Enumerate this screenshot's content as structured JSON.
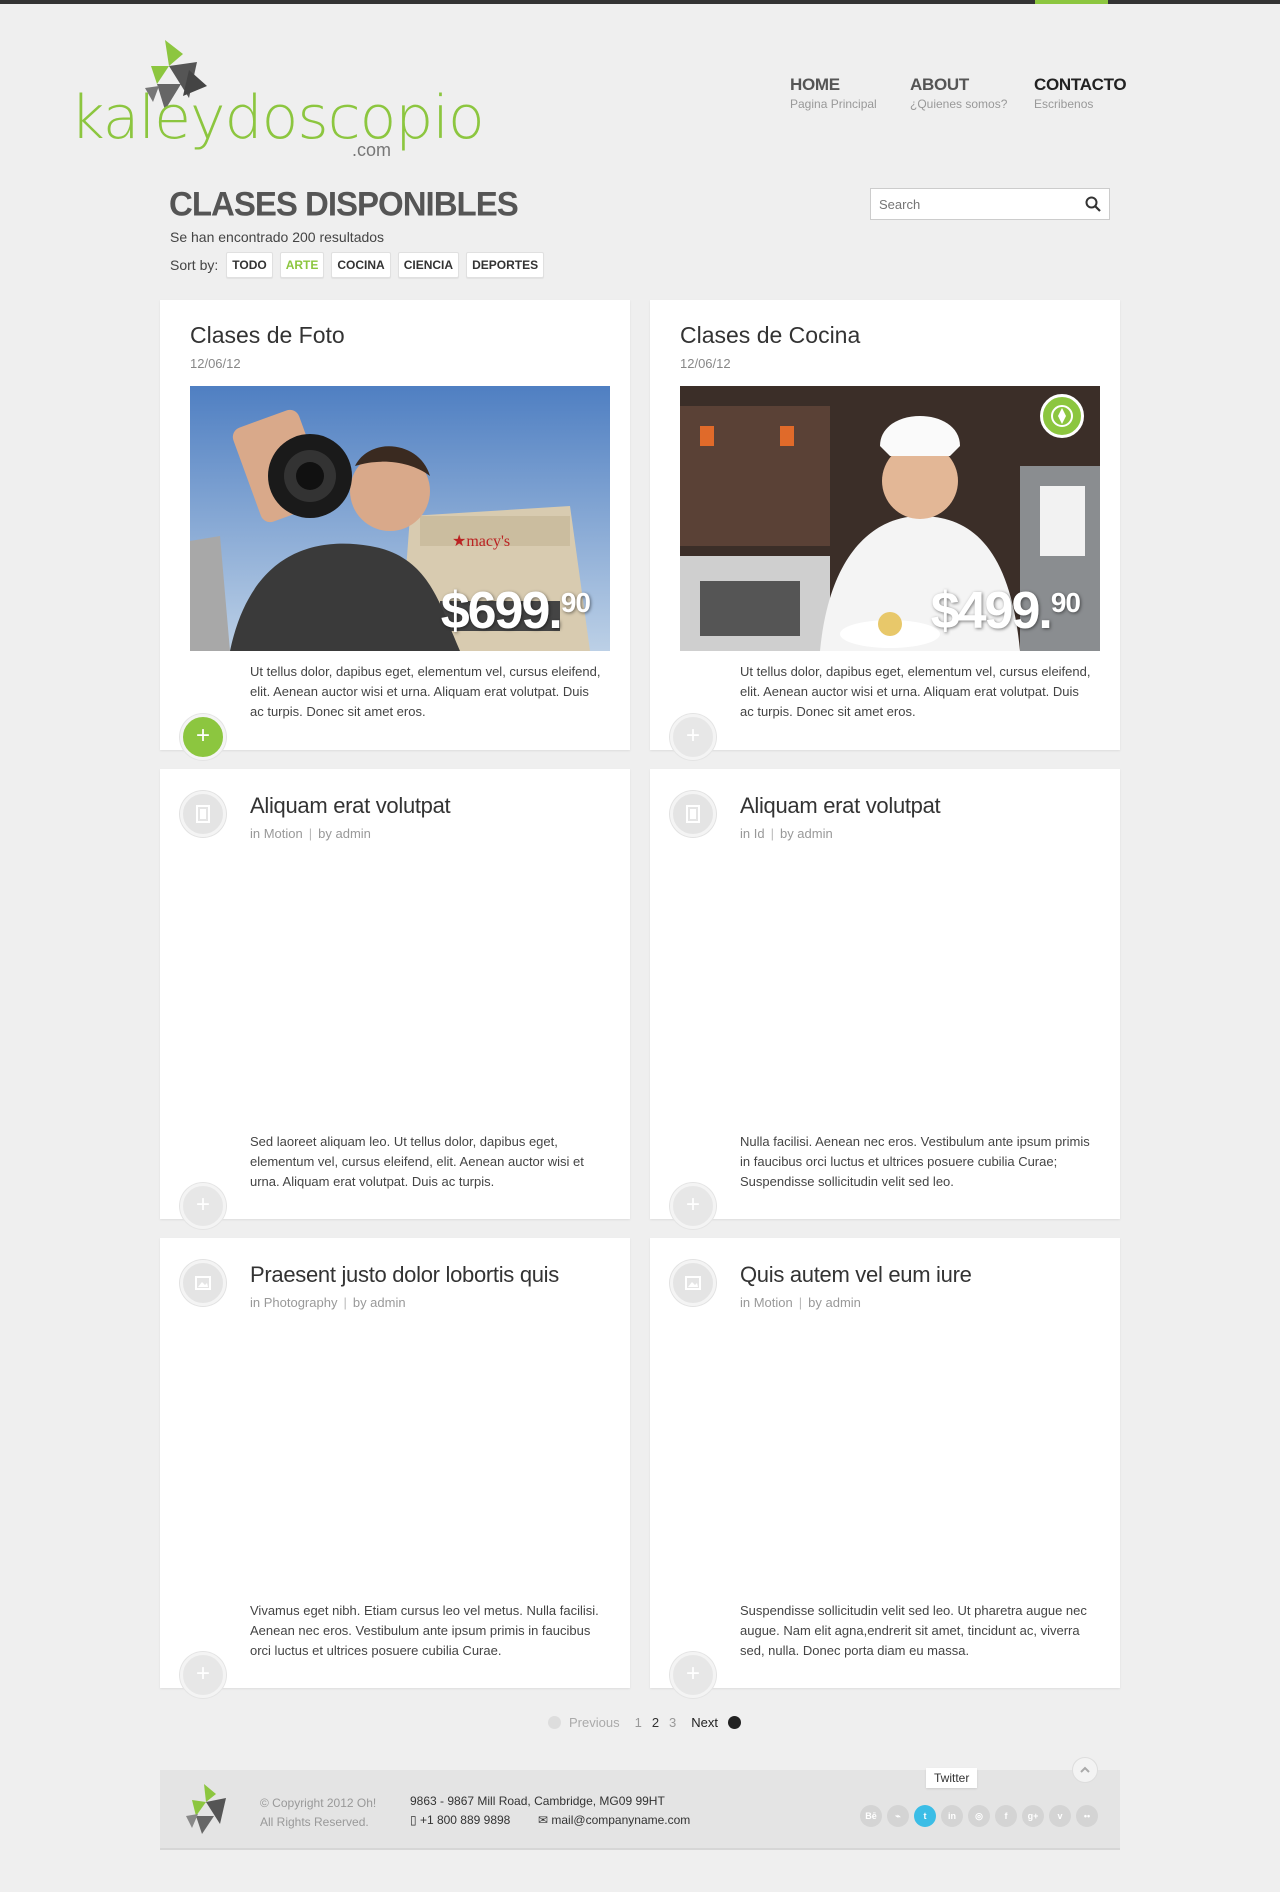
{
  "colors": {
    "accent": "#8cc63f",
    "twitter": "#3bbde6",
    "dark": "#333333"
  },
  "logo": {
    "text": "kaleydoscopio",
    "suffix": ".com"
  },
  "nav": [
    {
      "title": "HOME",
      "sub": "Pagina Principal"
    },
    {
      "title": "ABOUT",
      "sub": "¿Quienes somos?"
    },
    {
      "title": "CONTACTO",
      "sub": "Escribenos"
    }
  ],
  "page": {
    "title": "CLASES DISPONIBLES",
    "results": "Se han encontrado 200 resultados",
    "sort_label": "Sort by:",
    "sort_options": [
      "TODO",
      "ARTE",
      "COCINA",
      "CIENCIA",
      "DEPORTES"
    ],
    "sort_active": "ARTE"
  },
  "search": {
    "placeholder": "Search"
  },
  "cards": [
    {
      "title": "Clases de Foto",
      "date": "12/06/12",
      "price_main": "$699.",
      "price_cents": "90",
      "text": "Ut tellus dolor, dapibus eget, elementum vel, cursus eleifend, elit. Aenean auctor wisi et urna. Aliquam erat volutpat. Duis ac turpis. Donec sit amet eros."
    },
    {
      "title": "Clases de Cocina",
      "date": "12/06/12",
      "price_main": "$499.",
      "price_cents": "90",
      "text": "Ut tellus dolor, dapibus eget, elementum vel, cursus eleifend, elit. Aenean auctor wisi et urna. Aliquam erat volutpat. Duis ac turpis. Donec sit amet eros."
    }
  ],
  "posts": [
    {
      "title": "Aliquam erat volutpat",
      "category": "in Motion",
      "author": "by admin",
      "icon": "film-icon",
      "text": "Sed laoreet aliquam leo. Ut tellus dolor, dapibus eget, elementum vel, cursus eleifend, elit. Aenean auctor wisi et urna. Aliquam erat volutpat. Duis ac turpis."
    },
    {
      "title": "Aliquam erat volutpat",
      "category": "in Id",
      "author": "by admin",
      "icon": "film-icon",
      "text": "Nulla facilisi. Aenean nec eros. Vestibulum ante ipsum primis in faucibus orci luctus et ultrices posuere cubilia Curae; Suspendisse sollicitudin velit sed leo."
    },
    {
      "title": "Praesent justo dolor lobortis quis",
      "category": "in Photography",
      "author": "by admin",
      "icon": "image-icon",
      "text": "Vivamus eget nibh. Etiam cursus leo vel metus. Nulla facilisi. Aenean nec eros. Vestibulum ante ipsum primis in faucibus orci luctus et ultrices posuere cubilia Curae."
    },
    {
      "title": "Quis autem vel eum iure",
      "category": "in Motion",
      "author": "by admin",
      "icon": "image-icon",
      "text": "Suspendisse sollicitudin velit sed leo. Ut pharetra augue nec augue. Nam elit agna,endrerit sit amet, tincidunt ac, viverra sed, nulla. Donec porta diam eu massa."
    }
  ],
  "pagination": {
    "previous": "Previous",
    "pages": [
      "1",
      "2",
      "3"
    ],
    "current": "2",
    "next": "Next"
  },
  "footer": {
    "copyright": "© Copyright 2012 Oh!",
    "rights": "All Rights Reserved.",
    "address": "9863 - 9867 Mill Road, Cambridge, MG09 99HT",
    "phone": "+1 800 889 9898",
    "email": "mail@companyname.com",
    "tooltip": "Twitter",
    "socials": [
      "behance",
      "rss",
      "twitter",
      "linkedin",
      "dribbble",
      "facebook",
      "google-plus",
      "vimeo",
      "flickr"
    ],
    "social_glyphs": [
      "Bē",
      "⌁",
      "t",
      "in",
      "◎",
      "f",
      "g+",
      "v",
      "••"
    ]
  }
}
